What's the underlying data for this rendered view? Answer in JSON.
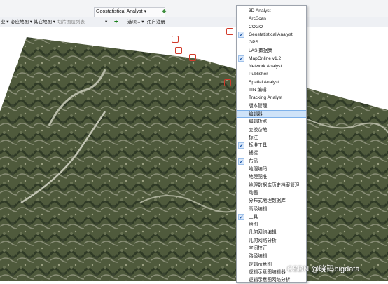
{
  "toolbar_top": {
    "geostat_dropdown": "Geostatistical Analyst ▾"
  },
  "toolbar_main": {
    "item1": "业 ▾",
    "item2": "必应地图 ▾",
    "item3": "其它地图 ▾",
    "item4": "切片图层列表",
    "item5": "选项... ▾",
    "item6": "用户注册"
  },
  "menu": {
    "items": [
      {
        "label": "3D Analyst",
        "checked": false
      },
      {
        "label": "ArcScan",
        "checked": false
      },
      {
        "label": "COGO",
        "checked": false
      },
      {
        "label": "Geostatistical Analyst",
        "checked": true
      },
      {
        "label": "GPS",
        "checked": false
      },
      {
        "label": "LAS 数据集",
        "checked": false
      },
      {
        "label": "MapOnline v1.2",
        "checked": true
      },
      {
        "label": "Network Analyst",
        "checked": false
      },
      {
        "label": "Publisher",
        "checked": false
      },
      {
        "label": "Spatial Analyst",
        "checked": false
      },
      {
        "label": "TIN 编辑",
        "checked": false
      },
      {
        "label": "Tracking Analyst",
        "checked": false
      },
      {
        "label": "版本管理",
        "checked": false
      },
      {
        "label": "编辑器",
        "checked": false,
        "highlighted": true
      },
      {
        "label": "编辑折点",
        "checked": false
      },
      {
        "label": "变换杂地",
        "checked": false
      },
      {
        "label": "标注",
        "checked": false
      },
      {
        "label": "标准工具",
        "checked": true
      },
      {
        "label": "捕捉",
        "checked": false
      },
      {
        "label": "布局",
        "checked": true
      },
      {
        "label": "地理编码",
        "checked": false
      },
      {
        "label": "地理配准",
        "checked": false
      },
      {
        "label": "地理数据库历史档案管理",
        "checked": false
      },
      {
        "label": "动画",
        "checked": false
      },
      {
        "label": "分布式地理数据库",
        "checked": false
      },
      {
        "label": "高级编辑",
        "checked": false
      },
      {
        "label": "工具",
        "checked": true
      },
      {
        "label": "绘图",
        "checked": false
      },
      {
        "label": "几何网络编辑",
        "checked": false
      },
      {
        "label": "几何网络分析",
        "checked": false
      },
      {
        "label": "空间校正",
        "checked": false
      },
      {
        "label": "路径编辑",
        "checked": false
      },
      {
        "label": "逻辑示意图",
        "checked": false
      },
      {
        "label": "逻辑示意图编辑器",
        "checked": false
      },
      {
        "label": "逻辑示意图网络分析",
        "checked": false
      }
    ]
  },
  "watermark": "CSDN @晓码bigdata",
  "colors": {
    "menu_highlight": "#cfe3f8",
    "check_bg": "#dbe9fa",
    "toolbar_bg": "#f3f4f6"
  }
}
